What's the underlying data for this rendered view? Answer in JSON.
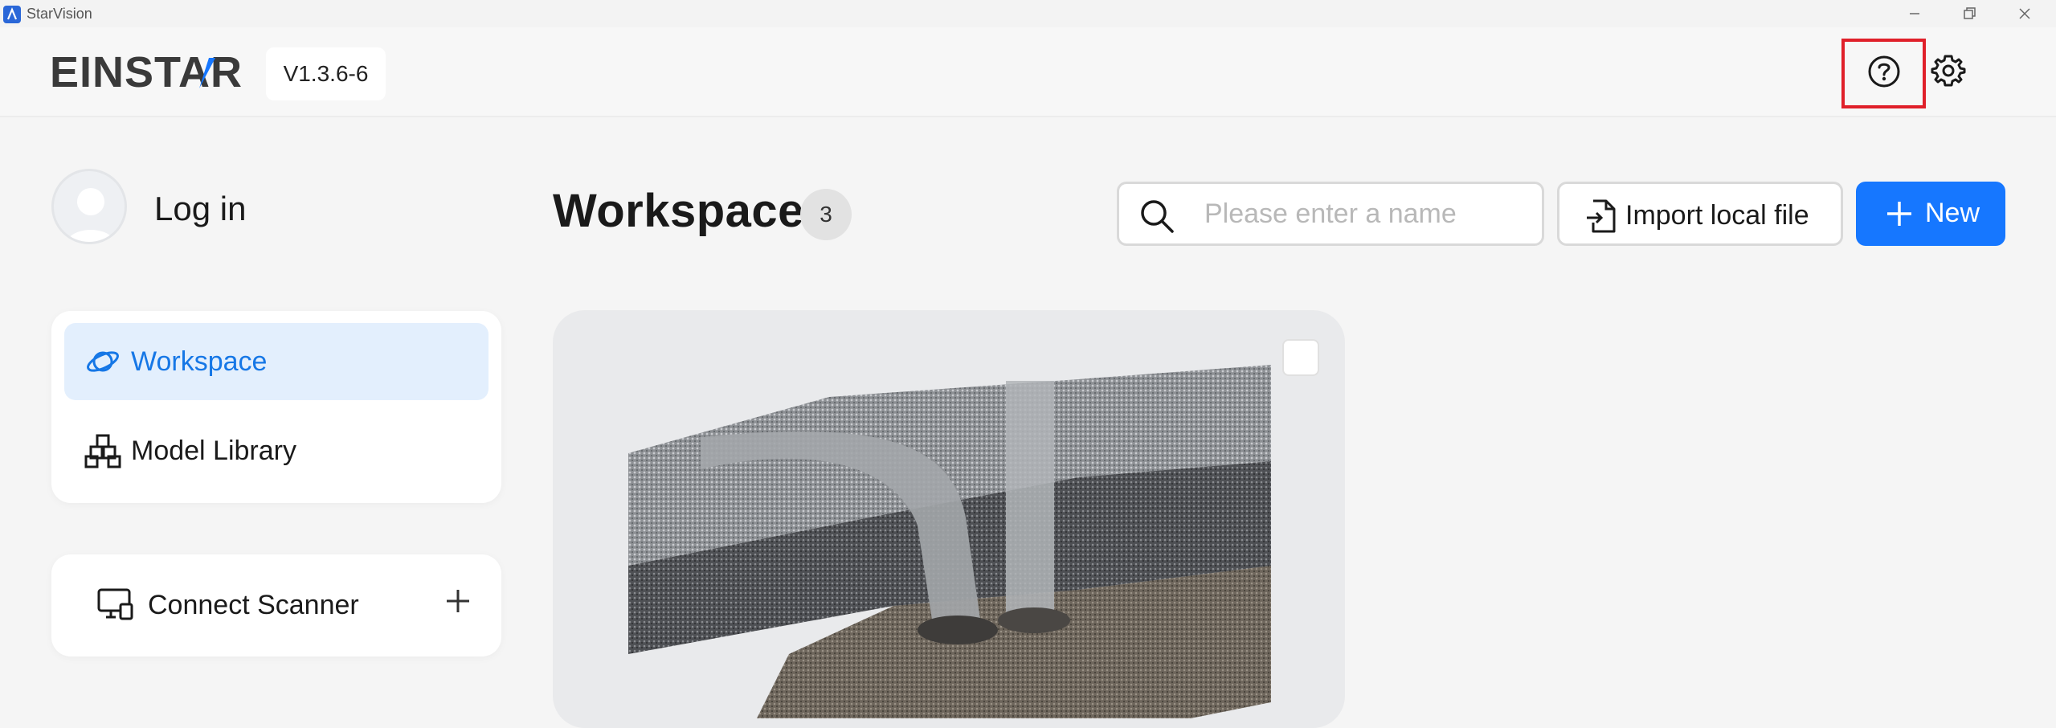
{
  "window": {
    "title": "StarVision",
    "controls": [
      "minimize-icon",
      "restore-icon",
      "close-icon"
    ]
  },
  "header": {
    "logo_text": "EINSTAR",
    "version": "V1.3.6-6",
    "help_icon": "help-circle-icon",
    "settings_icon": "gear-icon"
  },
  "sidebar": {
    "login_label": "Log in",
    "nav": [
      {
        "label": "Workspace",
        "icon": "planet-icon",
        "active": true
      },
      {
        "label": "Model Library",
        "icon": "cubes-icon",
        "active": false
      }
    ],
    "scanner": {
      "label": "Connect Scanner",
      "icon": "monitor-icon",
      "action_icon": "plus-icon"
    }
  },
  "main": {
    "title": "Workspace",
    "count": "3",
    "search": {
      "placeholder": "Please enter a name",
      "value": ""
    },
    "import_label": "Import local file",
    "new_label": "New"
  },
  "colors": {
    "accent": "#1677ff",
    "active_nav_bg": "#e3effd",
    "active_nav_text": "#1677e6",
    "highlight_border": "#e0202a"
  }
}
